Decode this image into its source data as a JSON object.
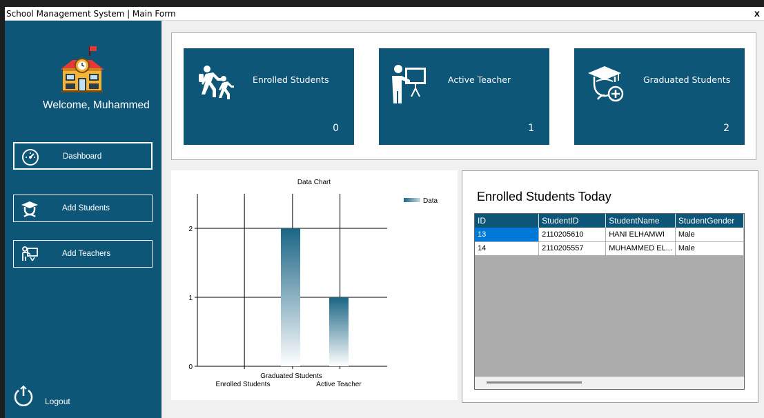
{
  "window": {
    "title": "School Management System | Main Form",
    "close": "x"
  },
  "sidebar": {
    "welcome": "Welcome, Muhammed",
    "items": [
      {
        "label": "Dashboard",
        "icon": "speedometer-icon"
      },
      {
        "label": "Add Students",
        "icon": "student-icon"
      },
      {
        "label": "Add Teachers",
        "icon": "teacher-icon"
      }
    ],
    "logout": "Logout"
  },
  "cards": [
    {
      "label": "Enrolled Students",
      "value": "0",
      "icon": "walking-students-icon"
    },
    {
      "label": "Active Teacher",
      "value": "1",
      "icon": "teacher-board-icon"
    },
    {
      "label": "Graduated Students",
      "value": "2",
      "icon": "graduate-cap-icon"
    }
  ],
  "chart_data": {
    "type": "bar",
    "title": "Data Chart",
    "categories": [
      "Enrolled Students",
      "Graduated Students",
      "Active Teacher"
    ],
    "series": [
      {
        "name": "Data",
        "values": [
          0,
          2,
          1
        ]
      }
    ],
    "ylim": [
      0,
      2
    ],
    "yticks": [
      "0",
      "1",
      "2"
    ],
    "grid": true,
    "legend": "top-right",
    "color": "#1b6585"
  },
  "grid": {
    "title": "Enrolled Students Today",
    "columns": [
      "ID",
      "StudentID",
      "StudentName",
      "StudentGender"
    ],
    "rows": [
      [
        "13",
        "2110205610",
        "HANI ELHAMWI",
        "Male"
      ],
      [
        "14",
        "2110205557",
        "MUHAMMED EL...",
        "Male"
      ]
    ]
  },
  "colors": {
    "accent": "#0e5677",
    "selection": "#0078d7"
  }
}
